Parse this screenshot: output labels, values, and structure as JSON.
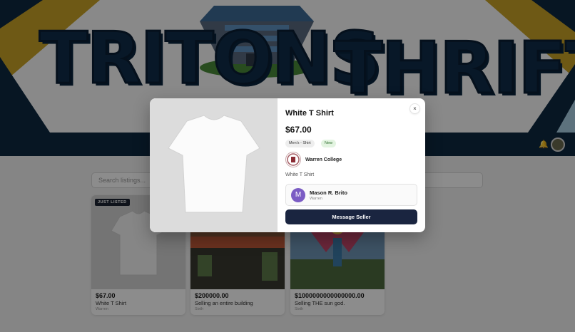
{
  "banner": {
    "word_left": "TRITONS",
    "word_right": "THRIFT",
    "colors": {
      "navy": "#0d2841",
      "gold": "#c9a227",
      "sky": "#a9cfe4"
    }
  },
  "navbar": {
    "bell_icon": "bell-icon",
    "avatar": "user-avatar"
  },
  "search": {
    "placeholder": "Search listings..."
  },
  "listings": [
    {
      "badge": "JUST LISTED",
      "price": "$67.00",
      "title": "White T Shirt",
      "college": "Warren"
    },
    {
      "price": "$200000.00",
      "title": "Selling an entire building",
      "college": "Sixth"
    },
    {
      "price": "$1000000000000000.00",
      "title": "Selling THE sun god.",
      "college": "Sixth"
    }
  ],
  "modal": {
    "title": "White T Shirt",
    "price": "$67.00",
    "category": "Men's - Shirt",
    "condition": "New",
    "college": "Warren College",
    "description": "White T Shirt",
    "seller": {
      "initial": "M",
      "name": "Mason R. Brito",
      "college": "Warren"
    },
    "message_button": "Message Seller",
    "close_glyph": "×"
  }
}
